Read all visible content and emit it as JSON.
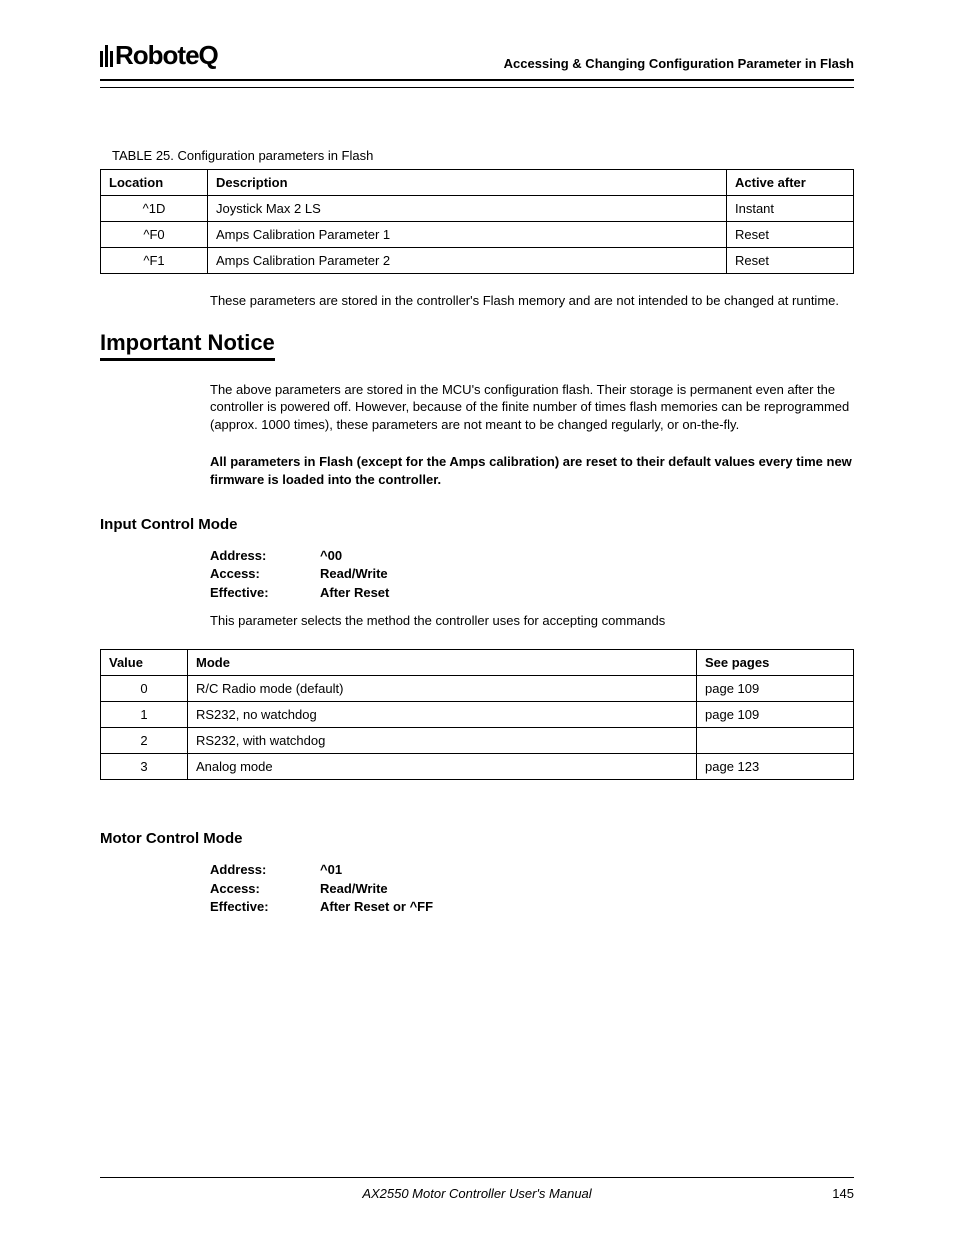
{
  "header": {
    "brand": "RoboteQ",
    "title": "Accessing & Changing Configuration Parameter in Flash"
  },
  "table25": {
    "caption_prefix": "TABLE 25. ",
    "caption": "Configuration parameters in Flash",
    "headers": {
      "c1": "Location",
      "c2": "Description",
      "c3": "Active after"
    },
    "rows": [
      {
        "c1": "^1D",
        "c2": "Joystick Max 2 LS",
        "c3": "Instant"
      },
      {
        "c1": "^F0",
        "c2": "Amps Calibration Parameter 1",
        "c3": "Reset"
      },
      {
        "c1": "^F1",
        "c2": "Amps Calibration Parameter 2",
        "c3": "Reset"
      }
    ]
  },
  "para1": "These parameters are stored in the controller's Flash memory and are not intended to be changed at runtime.",
  "notice_heading": "Important Notice",
  "notice_para": "The above parameters are stored in the MCU's configuration flash. Their storage is permanent even after the controller is powered off. However, because of the finite number of times flash memories can be reprogrammed (approx. 1000 times), these parameters are not meant to be changed regularly, or on-the-fly.",
  "notice_bold": "All parameters in Flash (except for the Amps calibration) are reset to their default values every time new firmware is loaded into the controller.",
  "input_mode": {
    "heading": "Input Control Mode",
    "kv": [
      {
        "label": "Address:",
        "value": "^00"
      },
      {
        "label": "Access:",
        "value": "Read/Write"
      },
      {
        "label": "Effective:",
        "value": "After Reset"
      }
    ],
    "desc": "This parameter selects the method the controller uses for accepting commands",
    "table": {
      "headers": {
        "c1": "Value",
        "c2": "Mode",
        "c3": "See pages"
      },
      "rows": [
        {
          "c1": "0",
          "c2": "R/C Radio mode (default)",
          "c3": "page 109"
        },
        {
          "c1": "1",
          "c2": "RS232, no watchdog",
          "c3": "page 109"
        },
        {
          "c1": "2",
          "c2": "RS232, with watchdog",
          "c3": ""
        },
        {
          "c1": "3",
          "c2": "Analog mode",
          "c3": "page 123"
        }
      ]
    }
  },
  "motor_mode": {
    "heading": "Motor Control Mode",
    "kv": [
      {
        "label": "Address:",
        "value": "^01"
      },
      {
        "label": "Access:",
        "value": "Read/Write"
      },
      {
        "label": "Effective:",
        "value": "After Reset or ^FF"
      }
    ]
  },
  "footer": {
    "title": "AX2550 Motor Controller User's Manual",
    "page": "145"
  }
}
